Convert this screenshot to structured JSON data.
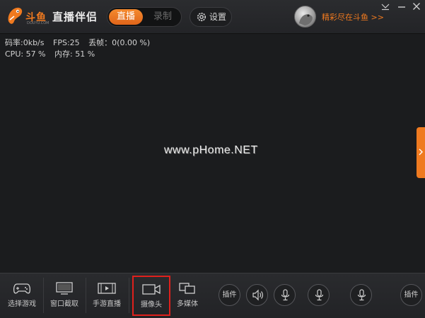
{
  "window": {
    "logo_text": "斗鱼",
    "logo_sub": "DOUYU.COM",
    "app_title": "直播伴侣",
    "tabs": [
      {
        "label": "直播",
        "active": true
      },
      {
        "label": "录制",
        "active": false
      }
    ],
    "settings_label": "设置",
    "promo_label": "精彩尽在斗鱼 >>",
    "accent_color": "#f07a1f"
  },
  "stats": {
    "bitrate": "码率:0kb/s",
    "fps": "FPS:25",
    "dropped": "丢帧：0(0.00 %)",
    "cpu": "CPU: 57 %",
    "memory": "内存: 51 %"
  },
  "preview": {
    "watermark": "www.pHome.NET"
  },
  "toolbar": {
    "items": [
      {
        "label": "选择游戏",
        "icon": "gamepad-icon"
      },
      {
        "label": "窗口截取",
        "icon": "monitor-icon"
      },
      {
        "label": "手游直播",
        "icon": "play-screen-icon"
      },
      {
        "label": "摄像头",
        "icon": "camera-icon",
        "selected": true
      },
      {
        "label": "多媒体",
        "icon": "multimedia-icon"
      }
    ],
    "plugin_label_1": "插件",
    "plugin_label_2": "插件",
    "selection_color": "#e0201c"
  }
}
